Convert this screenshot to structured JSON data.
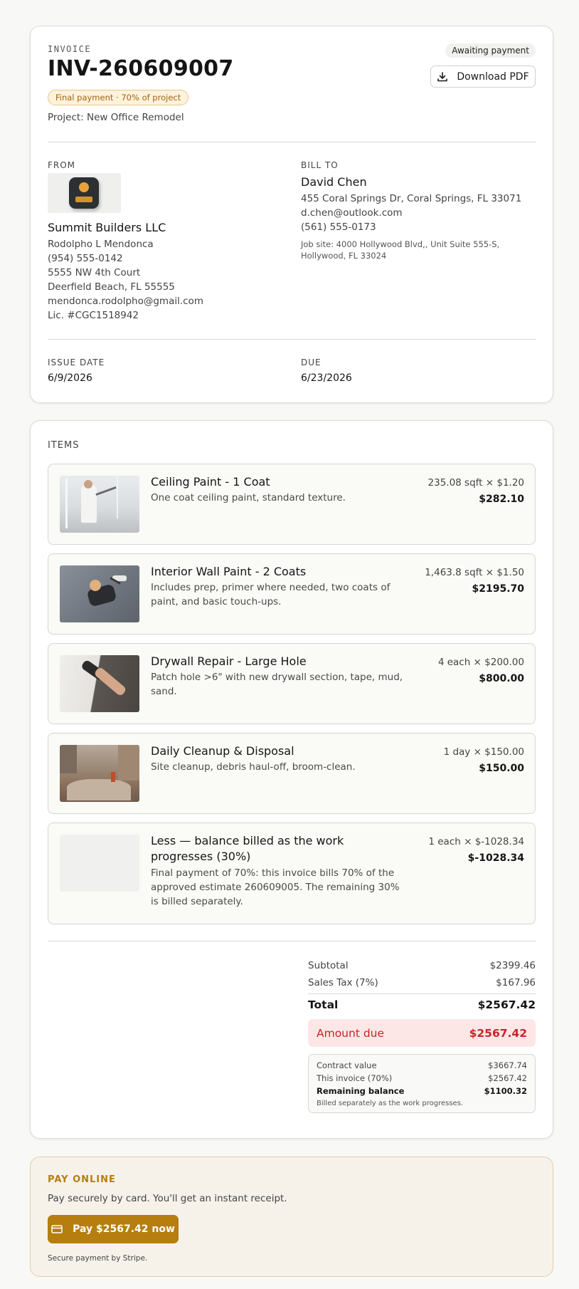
{
  "invoice": {
    "eyebrow": "INVOICE",
    "number": "INV-260609007",
    "badge": "Final payment · 70% of project",
    "project": "Project: New Office Remodel",
    "status": "Awaiting payment",
    "download_label": "Download PDF"
  },
  "from": {
    "label": "FROM",
    "company": "Summit Builders LLC",
    "lines": [
      "Rodolpho L Mendonca",
      "(954) 555-0142",
      "5555 NW 4th Court",
      "Deerfield Beach, FL 55555",
      "mendonca.rodolpho@gmail.com",
      "Lic. #CGC1518942"
    ]
  },
  "bill_to": {
    "label": "BILL TO",
    "name": "David Chen",
    "lines": [
      "455 Coral Springs Dr, Coral Springs, FL 33071",
      "d.chen@outlook.com",
      "(561) 555-0173"
    ],
    "job_site": "Job site: 4000 Hollywood Blvd,, Unit Suite 555-S, Hollywood, FL 33024"
  },
  "dates": {
    "issue_label": "ISSUE DATE",
    "issue": "6/9/2026",
    "due_label": "DUE",
    "due": "6/23/2026"
  },
  "items_label": "ITEMS",
  "items": [
    {
      "title": "Ceiling Paint - 1 Coat",
      "desc": "One coat ceiling paint, standard texture.",
      "qty": "235.08 sqft × $1.20",
      "amount": "$282.10"
    },
    {
      "title": "Interior Wall Paint - 2 Coats",
      "desc": "Includes prep, primer where needed, two coats of paint, and basic touch-ups.",
      "qty": "1,463.8 sqft × $1.50",
      "amount": "$2195.70"
    },
    {
      "title": "Drywall Repair - Large Hole",
      "desc": "Patch hole >6\" with new drywall section, tape, mud, sand.",
      "qty": "4 each × $200.00",
      "amount": "$800.00"
    },
    {
      "title": "Daily Cleanup & Disposal",
      "desc": "Site cleanup, debris haul-off, broom-clean.",
      "qty": "1 day × $150.00",
      "amount": "$150.00"
    },
    {
      "title": "Less — balance billed as the work progresses (30%)",
      "desc": "Final payment of 70%: this invoice bills 70% of the approved estimate 260609005. The remaining 30% is billed separately.",
      "qty": "1 each × $-1028.34",
      "amount": "$-1028.34"
    }
  ],
  "totals": {
    "subtotal_label": "Subtotal",
    "subtotal": "$2399.46",
    "tax_label": "Sales Tax (7%)",
    "tax": "$167.96",
    "total_label": "Total",
    "total": "$2567.42",
    "due_label": "Amount due",
    "due": "$2567.42"
  },
  "contract": {
    "value_label": "Contract value",
    "value": "$3667.74",
    "invoice_label": "This invoice (70%)",
    "invoice": "$2567.42",
    "remaining_label": "Remaining balance",
    "remaining": "$1100.32",
    "note": "Billed separately as the work progresses."
  },
  "pay": {
    "title": "PAY ONLINE",
    "subtitle": "Pay securely by card. You'll get an instant receipt.",
    "button": "Pay $2567.42 now",
    "footnote": "Secure payment by Stripe."
  },
  "colors": {
    "accent": "#b57e0e",
    "due_bg": "#fde6e6",
    "due_text": "#c8242a",
    "pay_bg": "#f6f2ea"
  }
}
